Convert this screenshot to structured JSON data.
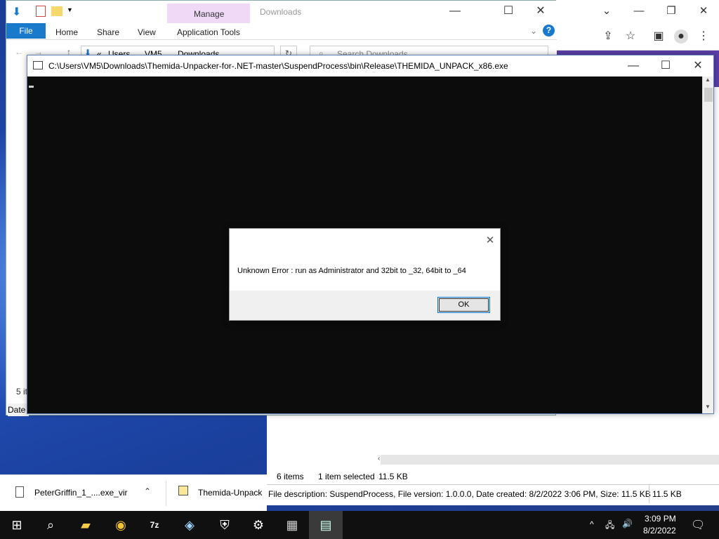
{
  "explorer": {
    "title": "Downloads",
    "context_tab": "Manage",
    "tabs": [
      "File",
      "Home",
      "Share",
      "View",
      "Application Tools"
    ],
    "breadcrumb": [
      "Users",
      "VM5",
      "Downloads"
    ],
    "breadcrumb_prefix": "«",
    "search_placeholder": "Search Downloads",
    "side_count": "5 it",
    "side_header": "Date"
  },
  "console": {
    "title": "C:\\Users\\VM5\\Downloads\\Themida-Unpacker-for-.NET-master\\SuspendProcess\\bin\\Release\\THEMIDA_UNPACK_x86.exe"
  },
  "dialog": {
    "message": "Unknown Error : run as Administrator and 32bit to _32, 64bit to _64",
    "ok_label": "OK"
  },
  "status": {
    "items": "6 items",
    "selected": "1 item selected",
    "size": "11.5 KB",
    "file_description": "File description: SuspendProcess, File version: 1.0.0.0, Date created: 8/2/2022 3:06 PM, Size: 11.5 KB",
    "size_right": "11.5 KB"
  },
  "downloads_bar": {
    "item1": "PeterGriffin_1_....exe_vir",
    "item2": "Themida-Unpack"
  },
  "taskbar": {
    "time": "3:09 PM",
    "date": "8/2/2022"
  },
  "colors": {
    "accent": "#1979ca",
    "manage_tab": "#efd9f7",
    "console_bg": "#0c0c0c",
    "taskbar": "#101010"
  }
}
